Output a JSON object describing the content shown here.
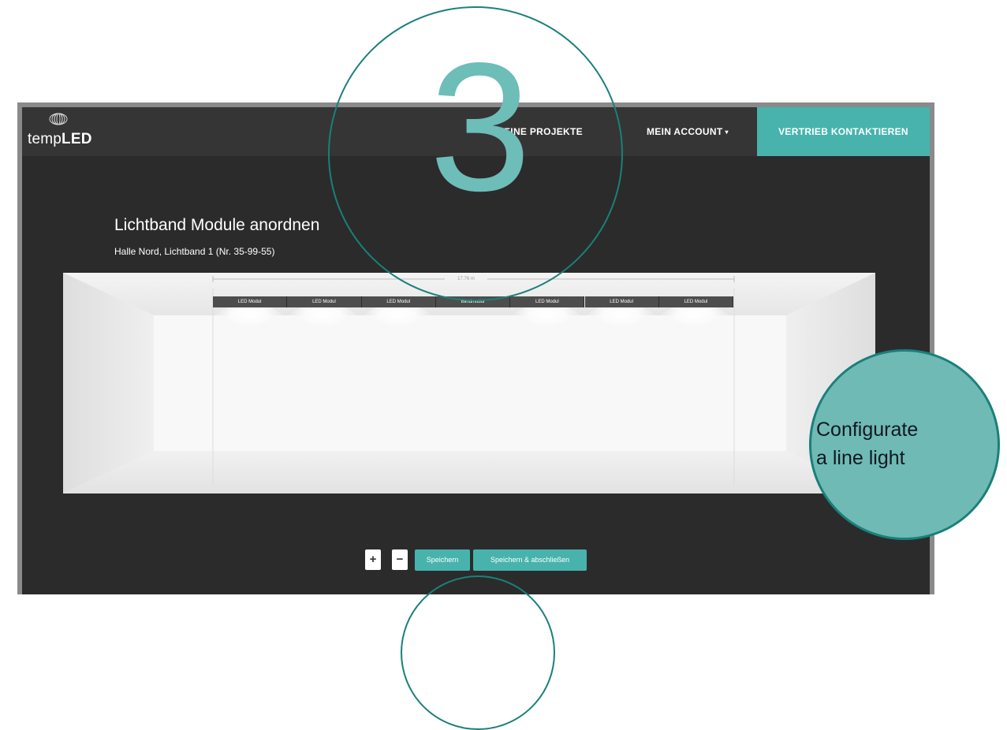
{
  "navbar": {
    "logo_prefix": "temp",
    "logo_suffix": "LED",
    "projects_label": "EINE PROJEKTE",
    "account_label": "MEIN ACCOUNT",
    "account_caret": "▾",
    "contact_label": "VERTRIEB KONTAKTIEREN"
  },
  "page": {
    "title": "Lichtband Module anordnen",
    "subtitle": "Halle Nord, Lichtband 1 (Nr. 35-99-55)"
  },
  "lightband": {
    "length_label": "17.76 m",
    "modules": [
      {
        "label": "LED Modul"
      },
      {
        "label": "LED Modul"
      },
      {
        "label": "LED Modul"
      },
      {
        "label": "Blindmodul"
      },
      {
        "label": "LED Modul"
      },
      {
        "label": "LED Modul"
      },
      {
        "label": "LED Modul"
      }
    ]
  },
  "controls": {
    "add_label": "+",
    "remove_label": "−",
    "save_label": "Speichern",
    "save_close_label": "Speichern & abschließen"
  },
  "overlay": {
    "step_number": "3",
    "caption_line1": "Configurate",
    "caption_line2": "a line light"
  },
  "colors": {
    "accent": "#48b3ad",
    "circle_outline": "#1a807a",
    "badge_fill": "#6fbab5",
    "app_background": "#2b2b2b"
  }
}
